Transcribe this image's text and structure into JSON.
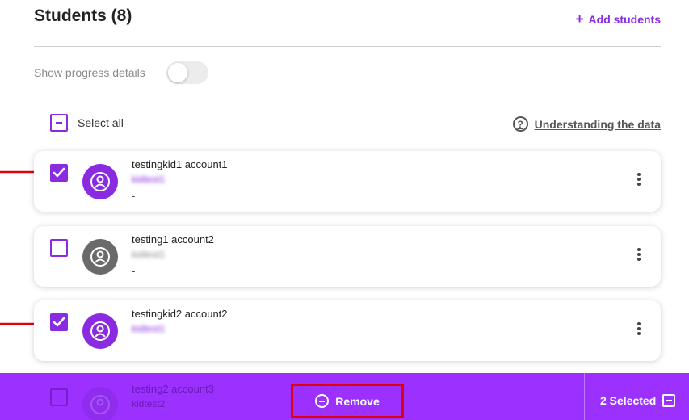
{
  "header": {
    "title": "Students (8)",
    "add_label": "Add students"
  },
  "progress": {
    "label": "Show progress details",
    "enabled": false
  },
  "select_all": {
    "label": "Select all"
  },
  "help_link": {
    "label": "Understanding the data"
  },
  "students": [
    {
      "name": "testingkid1 account1",
      "username": "kidtest1",
      "detail": "-",
      "checked": true,
      "avatar_color": "purple"
    },
    {
      "name": "testing1 account2",
      "username": "kidtest1",
      "detail": "-",
      "checked": false,
      "avatar_color": "gray"
    },
    {
      "name": "testingkid2 account2",
      "username": "kidtest1",
      "detail": "-",
      "checked": true,
      "avatar_color": "purple"
    },
    {
      "name": "testing2 account3",
      "username": "kidtest2",
      "detail": "",
      "checked": false,
      "avatar_color": "purple"
    }
  ],
  "bottom_bar": {
    "remove_label": "Remove",
    "selected_label": "2 Selected"
  },
  "colors": {
    "accent": "#8a2be2",
    "bar": "#9b30ff",
    "highlight": "#e0000f"
  }
}
